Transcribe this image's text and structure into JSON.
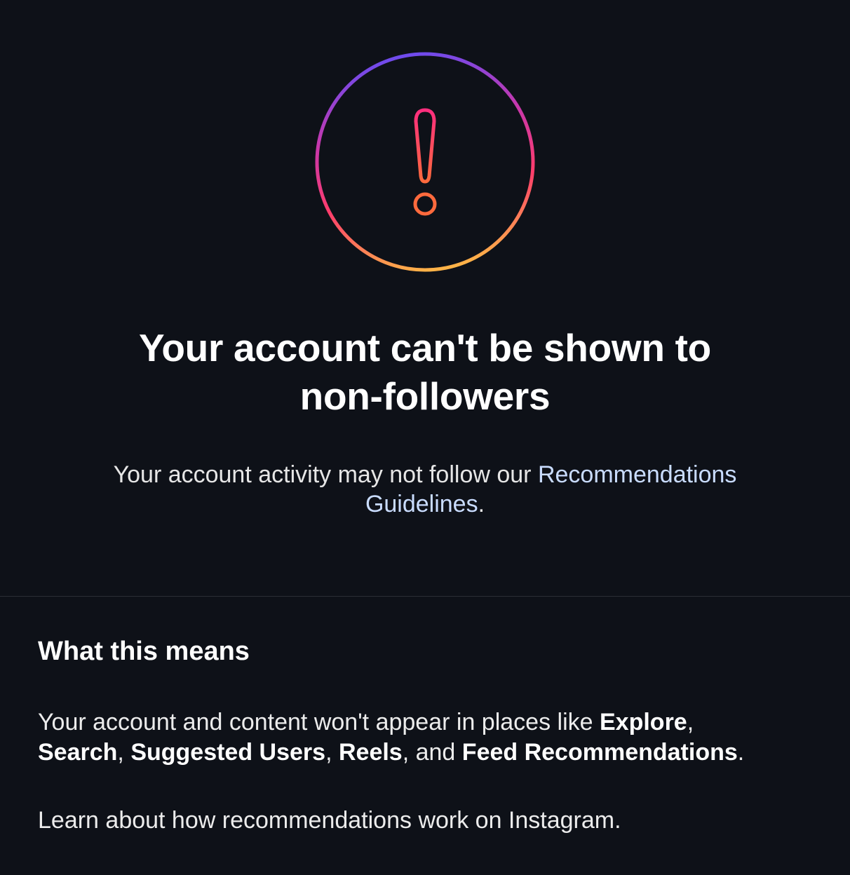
{
  "alert": {
    "icon": "exclamation-circle-icon",
    "gradient_colors": [
      "#6a4cf0",
      "#c837ab",
      "#ff3d6b",
      "#ffb347"
    ]
  },
  "headline": {
    "line1": "Your account can't be shown to",
    "line2": "non-followers"
  },
  "subtitle": {
    "text_prefix": "Your account activity may not follow our ",
    "link_part1": "Recommendations",
    "link_part2": "Guidelines",
    "suffix": "."
  },
  "section": {
    "heading": "What this means",
    "body": {
      "t1": "Your account and content won't appear in places like ",
      "b1": "Explore",
      "t2": ",",
      "b2": "Search",
      "t3": ", ",
      "b3": "Suggested Users",
      "t4": ", ",
      "b4": "Reels",
      "t5": ", and ",
      "b5": "Feed Recommendations",
      "t6": "."
    },
    "learn_more": "Learn about how recommendations work on Instagram."
  },
  "colors": {
    "background": "#0e1118",
    "link": "#c9dcff",
    "divider": "#2b2e36"
  }
}
